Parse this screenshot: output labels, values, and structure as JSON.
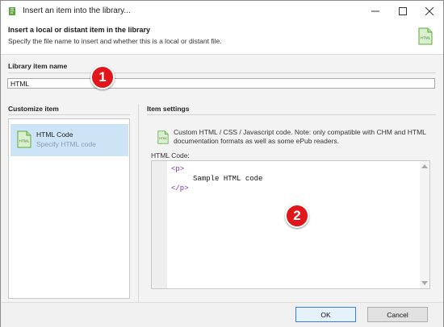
{
  "window": {
    "title": "Insert an item into the library...",
    "controls": {
      "minimize": "minimize-icon",
      "maximize": "maximize-icon",
      "close": "close-icon"
    }
  },
  "header": {
    "title": "Insert a local or distant item in the library",
    "subtitle": "Specify the file name to insert and whether this is a local or distant file.",
    "icon": "html-file-icon",
    "icon_text": "HTML"
  },
  "library_item": {
    "label": "Library item name",
    "value": "HTML"
  },
  "customize": {
    "label": "Customize item",
    "items": [
      {
        "title": "HTML Code",
        "subtitle": "Specify HTML code",
        "icon": "html-file-icon",
        "icon_text": "HTML",
        "selected": true
      }
    ]
  },
  "settings": {
    "label": "Item settings",
    "description": "Custom HTML / CSS / Javascript code. Note: only compatible with CHM and HTML documentation formats as well as some ePub readers.",
    "code_label": "HTML Code:",
    "code": {
      "open_tag": "<p>",
      "text": "Sample HTML code",
      "close_tag": "</p>"
    }
  },
  "buttons": {
    "ok": "OK",
    "cancel": "Cancel"
  },
  "callouts": [
    "1",
    "2"
  ],
  "colors": {
    "accent": "#3b7fd8",
    "selection": "#cde4f7",
    "callout": "#e0161b",
    "code_tag": "#7b2fa0",
    "code_bracket": "#2b2bd6"
  }
}
